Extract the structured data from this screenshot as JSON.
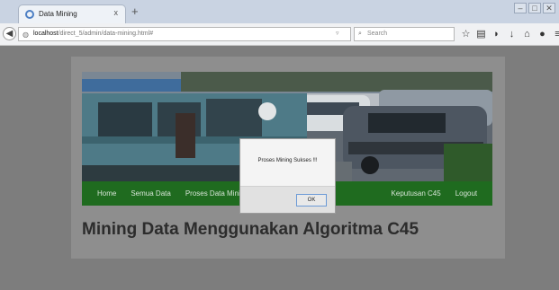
{
  "browser": {
    "tab": {
      "title": "Data Mining",
      "close": "x"
    },
    "new_tab": "+",
    "window_buttons": [
      "–",
      "□",
      "✕"
    ],
    "url": {
      "host": "localhost",
      "path": "/direct_5/admin/data-mining.html#"
    },
    "search_placeholder": "Search",
    "toolbar_icons": [
      "star-icon",
      "reading-list-icon",
      "pocket-icon",
      "download-icon",
      "home-icon",
      "chat-icon",
      "menu-icon"
    ]
  },
  "site": {
    "menu": [
      "Home",
      "Semua Data",
      "Proses Data Mining C45",
      "Keputusan C45",
      "Logout"
    ],
    "heading": "Mining Data Menggunakan Algoritma C45",
    "menu_color": "#1f6b1f"
  },
  "dialog": {
    "message": "Proses Mining Sukses !!!",
    "ok_label": "OK"
  }
}
